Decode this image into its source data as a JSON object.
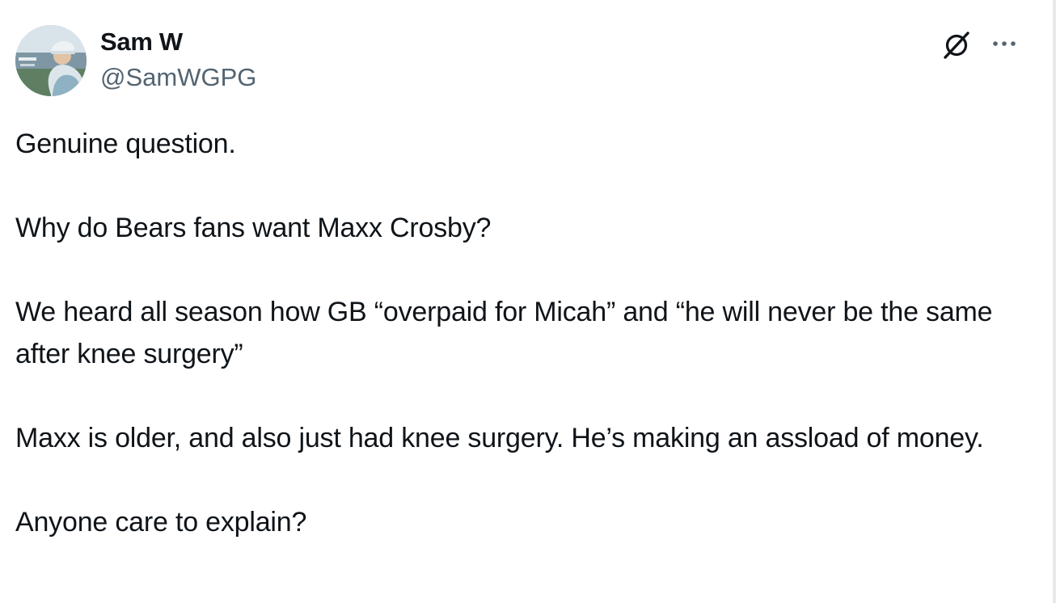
{
  "author": {
    "name": "Sam W",
    "handle": "@SamWGPG",
    "avatar_icon": "profile-photo"
  },
  "header_actions": {
    "grok_icon": "grok-slash-icon",
    "more_icon": "more-dots-icon"
  },
  "tweet": {
    "paragraphs": [
      "Genuine question.",
      "Why do Bears fans want Maxx Crosby?",
      "We heard all season how GB “overpaid for Micah” and “he will never be the same after knee surgery”",
      "Maxx is older, and also just had knee surgery. He’s making an assload of money.",
      "Anyone care to explain?"
    ]
  },
  "colors": {
    "text": "#0f1419",
    "secondary_text": "#536471",
    "background": "#ffffff",
    "border": "#e7e9ea"
  }
}
